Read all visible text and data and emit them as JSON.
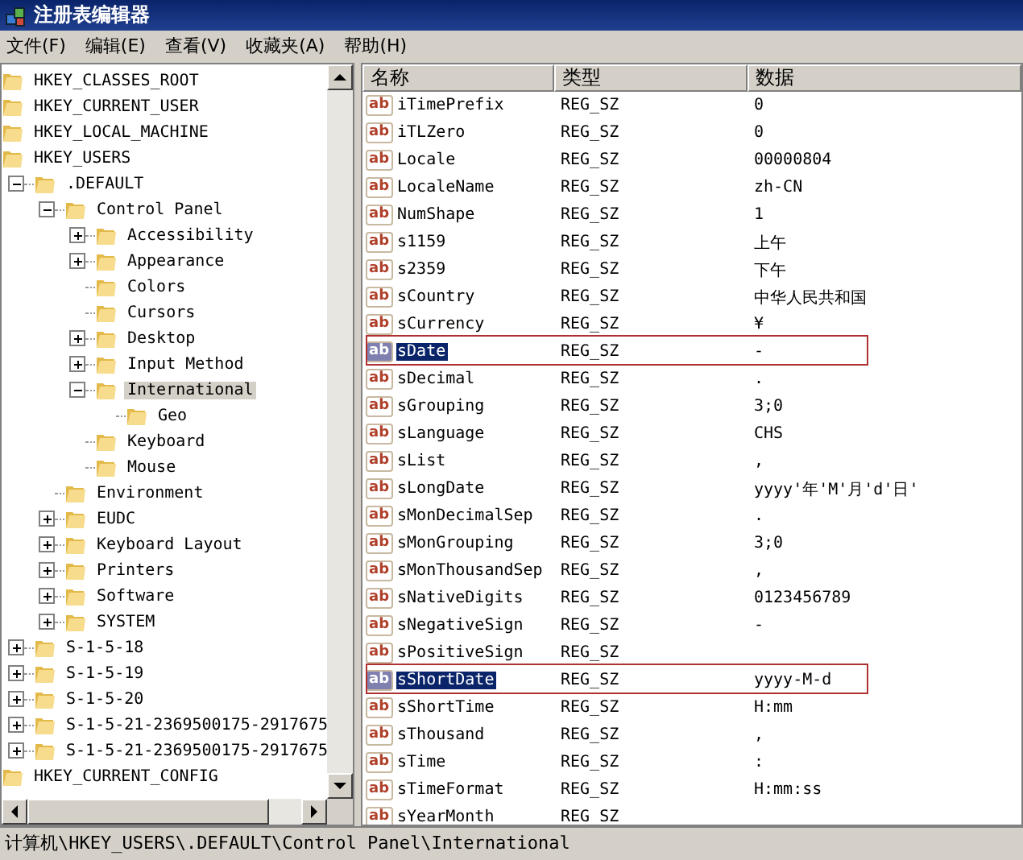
{
  "window": {
    "title": "注册表编辑器"
  },
  "menu": [
    "文件(F)",
    "编辑(E)",
    "查看(V)",
    "收藏夹(A)",
    "帮助(H)"
  ],
  "tree": [
    {
      "label": "HKEY_CLASSES_ROOT",
      "selected": false
    },
    {
      "label": "HKEY_CURRENT_USER",
      "selected": false
    },
    {
      "label": "HKEY_LOCAL_MACHINE",
      "selected": false
    },
    {
      "label": "HKEY_USERS",
      "selected": false,
      "children": [
        {
          "label": ".DEFAULT",
          "expanded": true,
          "selected": false,
          "children": [
            {
              "label": "Control Panel",
              "expanded": true,
              "selected": false,
              "children": [
                {
                  "label": "Accessibility",
                  "expanded": false,
                  "selected": false
                },
                {
                  "label": "Appearance",
                  "expanded": false,
                  "selected": false
                },
                {
                  "label": "Colors",
                  "selected": false
                },
                {
                  "label": "Cursors",
                  "selected": false
                },
                {
                  "label": "Desktop",
                  "expanded": false,
                  "selected": false
                },
                {
                  "label": "Input Method",
                  "expanded": false,
                  "selected": false
                },
                {
                  "label": "International",
                  "expanded": true,
                  "selected": true,
                  "children": [
                    {
                      "label": "Geo",
                      "selected": false
                    }
                  ]
                },
                {
                  "label": "Keyboard",
                  "selected": false
                },
                {
                  "label": "Mouse",
                  "selected": false
                }
              ]
            },
            {
              "label": "Environment",
              "selected": false
            },
            {
              "label": "EUDC",
              "expanded": false,
              "selected": false
            },
            {
              "label": "Keyboard Layout",
              "expanded": false,
              "selected": false
            },
            {
              "label": "Printers",
              "expanded": false,
              "selected": false
            },
            {
              "label": "Software",
              "expanded": false,
              "selected": false
            },
            {
              "label": "SYSTEM",
              "expanded": false,
              "selected": false
            }
          ]
        },
        {
          "label": "S-1-5-18",
          "expanded": false,
          "selected": false
        },
        {
          "label": "S-1-5-19",
          "expanded": false,
          "selected": false
        },
        {
          "label": "S-1-5-20",
          "expanded": false,
          "selected": false
        },
        {
          "label": "S-1-5-21-2369500175-2917675",
          "expanded": false,
          "selected": false
        },
        {
          "label": "S-1-5-21-2369500175-2917675",
          "expanded": false,
          "selected": false
        }
      ]
    },
    {
      "label": "HKEY_CURRENT_CONFIG",
      "selected": false
    }
  ],
  "table": {
    "columns": [
      "名称",
      "类型",
      "数据"
    ],
    "rows": [
      {
        "icon": "ab",
        "name": "iTimePrefix",
        "type": "REG_SZ",
        "data": "0",
        "selected": false,
        "annotated": false
      },
      {
        "icon": "ab",
        "name": "iTLZero",
        "type": "REG_SZ",
        "data": "0",
        "selected": false,
        "annotated": false
      },
      {
        "icon": "ab",
        "name": "Locale",
        "type": "REG_SZ",
        "data": "00000804",
        "selected": false,
        "annotated": false
      },
      {
        "icon": "ab",
        "name": "LocaleName",
        "type": "REG_SZ",
        "data": "zh-CN",
        "selected": false,
        "annotated": false
      },
      {
        "icon": "ab",
        "name": "NumShape",
        "type": "REG_SZ",
        "data": "1",
        "selected": false,
        "annotated": false
      },
      {
        "icon": "ab",
        "name": "s1159",
        "type": "REG_SZ",
        "data": "上午",
        "selected": false,
        "annotated": false
      },
      {
        "icon": "ab",
        "name": "s2359",
        "type": "REG_SZ",
        "data": "下午",
        "selected": false,
        "annotated": false
      },
      {
        "icon": "ab",
        "name": "sCountry",
        "type": "REG_SZ",
        "data": "中华人民共和国",
        "selected": false,
        "annotated": false
      },
      {
        "icon": "ab",
        "name": "sCurrency",
        "type": "REG_SZ",
        "data": "¥",
        "selected": false,
        "annotated": false
      },
      {
        "icon": "ab",
        "name": "sDate",
        "type": "REG_SZ",
        "data": "-",
        "selected": true,
        "annotated": true
      },
      {
        "icon": "ab",
        "name": "sDecimal",
        "type": "REG_SZ",
        "data": ".",
        "selected": false,
        "annotated": false
      },
      {
        "icon": "ab",
        "name": "sGrouping",
        "type": "REG_SZ",
        "data": "3;0",
        "selected": false,
        "annotated": false
      },
      {
        "icon": "ab",
        "name": "sLanguage",
        "type": "REG_SZ",
        "data": "CHS",
        "selected": false,
        "annotated": false
      },
      {
        "icon": "ab",
        "name": "sList",
        "type": "REG_SZ",
        "data": ",",
        "selected": false,
        "annotated": false
      },
      {
        "icon": "ab",
        "name": "sLongDate",
        "type": "REG_SZ",
        "data": "yyyy'年'M'月'd'日'",
        "selected": false,
        "annotated": false
      },
      {
        "icon": "ab",
        "name": "sMonDecimalSep",
        "type": "REG_SZ",
        "data": ".",
        "selected": false,
        "annotated": false
      },
      {
        "icon": "ab",
        "name": "sMonGrouping",
        "type": "REG_SZ",
        "data": "3;0",
        "selected": false,
        "annotated": false
      },
      {
        "icon": "ab",
        "name": "sMonThousandSep",
        "type": "REG_SZ",
        "data": ",",
        "selected": false,
        "annotated": false
      },
      {
        "icon": "ab",
        "name": "sNativeDigits",
        "type": "REG_SZ",
        "data": "0123456789",
        "selected": false,
        "annotated": false
      },
      {
        "icon": "ab",
        "name": "sNegativeSign",
        "type": "REG_SZ",
        "data": "-",
        "selected": false,
        "annotated": false
      },
      {
        "icon": "ab",
        "name": "sPositiveSign",
        "type": "REG_SZ",
        "selected": false,
        "annotated": false
      },
      {
        "icon": "ab",
        "name": "sShortDate",
        "type": "REG_SZ",
        "data": "yyyy-M-d",
        "selected": true,
        "annotated": true
      },
      {
        "icon": "ab",
        "name": "sShortTime",
        "type": "REG_SZ",
        "data": "H:mm",
        "selected": false,
        "annotated": false
      },
      {
        "icon": "ab",
        "name": "sThousand",
        "type": "REG_SZ",
        "data": ",",
        "selected": false,
        "annotated": false
      },
      {
        "icon": "ab",
        "name": "sTime",
        "type": "REG_SZ",
        "data": ":",
        "selected": false,
        "annotated": false
      },
      {
        "icon": "ab",
        "name": "sTimeFormat",
        "type": "REG_SZ",
        "data": "H:mm:ss",
        "selected": false,
        "annotated": false
      },
      {
        "icon": "ab",
        "name": "sYearMonth",
        "type": "REG_SZ",
        "selected": false,
        "annotated": false
      }
    ]
  },
  "status_bar": "计算机\\HKEY_USERS\\.DEFAULT\\Control Panel\\International"
}
